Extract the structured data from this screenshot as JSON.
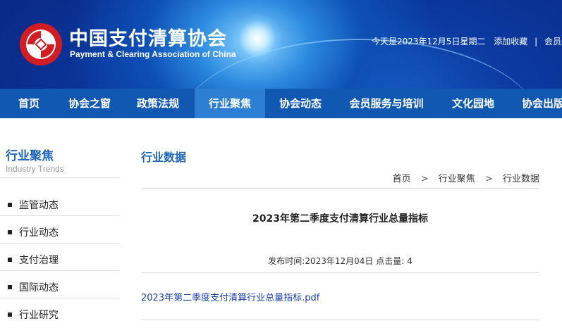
{
  "header": {
    "logo_cn": "中国支付清算协会",
    "logo_en": "Payment & Clearing Association of China",
    "date_text": "今天是2023年12月5日星期二",
    "favorite_link": "添加收藏",
    "separator": "|",
    "login_link": "会员登录"
  },
  "nav": {
    "items": [
      {
        "label": "首页"
      },
      {
        "label": "协会之窗"
      },
      {
        "label": "政策法规"
      },
      {
        "label": "行业聚焦"
      },
      {
        "label": "协会动态"
      },
      {
        "label": "会员服务与培训"
      },
      {
        "label": "文化园地"
      },
      {
        "label": "协会出版"
      }
    ],
    "active_index": 3,
    "color": "#1158b3",
    "active_color": "#2d7fd4"
  },
  "sidebar": {
    "title": "行业聚焦",
    "subtitle": "Industry Trends",
    "items": [
      {
        "label": "监管动态"
      },
      {
        "label": "行业动态"
      },
      {
        "label": "支付治理"
      },
      {
        "label": "国际动态"
      },
      {
        "label": "行业研究"
      }
    ]
  },
  "main": {
    "section_title": "行业数据",
    "breadcrumb": [
      "首页",
      "行业聚焦",
      "行业数据"
    ],
    "breadcrumb_sep": ">",
    "article_title": "2023年第二季度支付清算行业总量指标",
    "meta": "发布时间:2023年12月04日 点击量: 4",
    "attachment": "2023年第二季度支付清算行业总量指标.pdf"
  },
  "colors": {
    "accent_blue": "#1d64b8",
    "link_blue": "#1a3fa8"
  }
}
